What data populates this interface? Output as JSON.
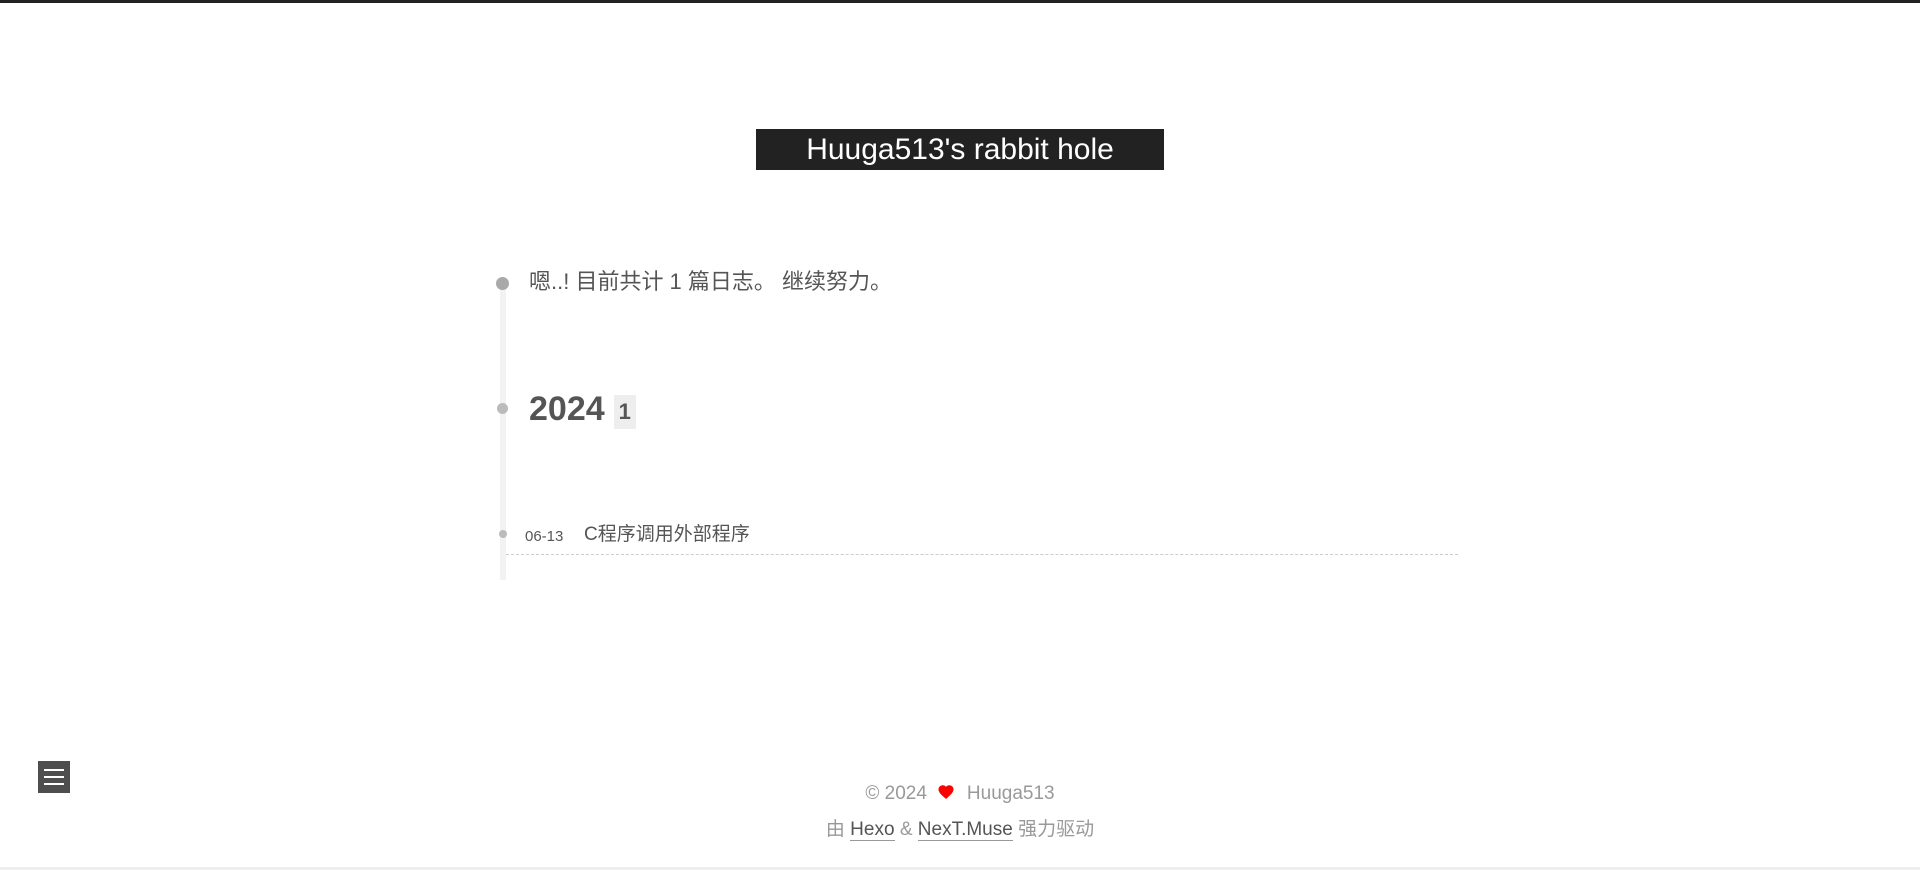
{
  "site": {
    "title": "Huuga513's rabbit hole"
  },
  "archive": {
    "summary": "嗯..! 目前共计 1 篇日志。 继续努力。",
    "years": [
      {
        "year": "2024",
        "count": "1",
        "posts": [
          {
            "date": "06-13",
            "title": "C程序调用外部程序"
          }
        ]
      }
    ]
  },
  "footer": {
    "copyright": "© 2024",
    "author": "Huuga513",
    "powered_prefix": "由",
    "hexo_link": "Hexo",
    "amp": "&",
    "theme_link": "NexT.Muse",
    "powered_suffix": "强力驱动"
  },
  "colors": {
    "header_bg": "#222222",
    "heart": "#ff0000",
    "timeline": "#f2f2f2"
  },
  "icons": {
    "menu": "menu-icon",
    "heart": "heart-icon"
  }
}
